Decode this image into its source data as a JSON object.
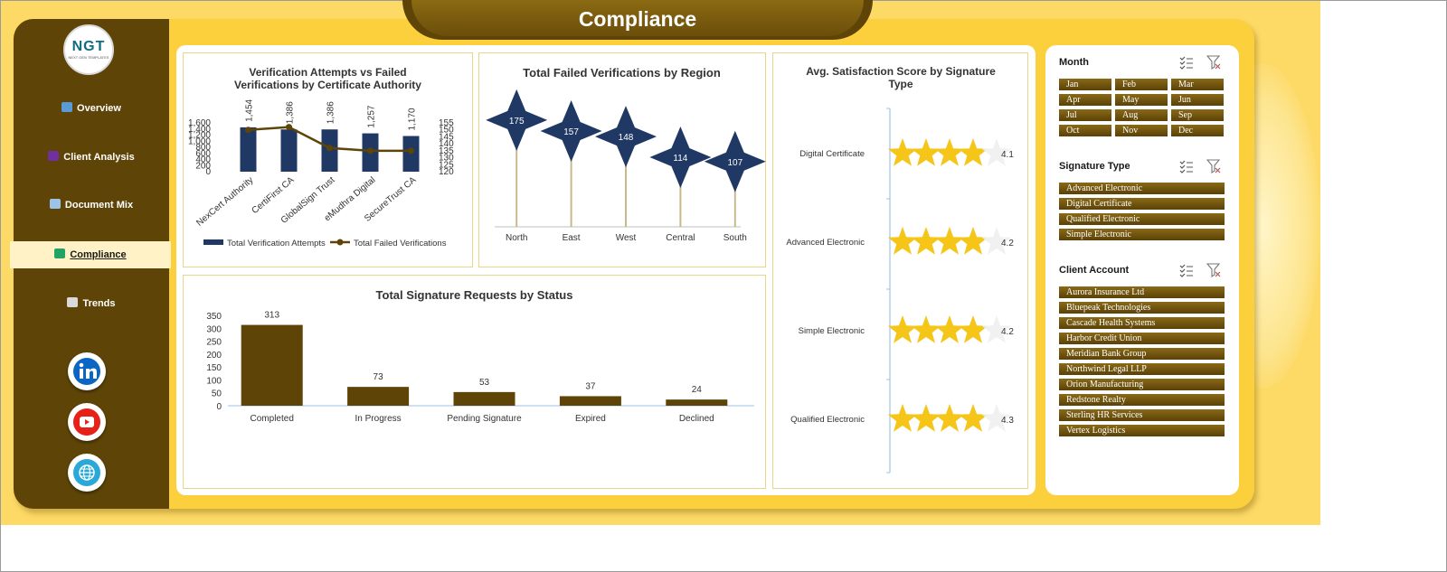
{
  "title": "Compliance",
  "logo": {
    "text": "NGT",
    "subtext": "NEXT GEN TEMPLATES"
  },
  "nav": [
    {
      "label": "Overview",
      "icon": "bar-chart-icon"
    },
    {
      "label": "Client Analysis",
      "icon": "people-icon"
    },
    {
      "label": "Document Mix",
      "icon": "line-chart-icon"
    },
    {
      "label": "Compliance",
      "icon": "check-icon",
      "active": true
    },
    {
      "label": "Trends",
      "icon": "clipboard-icon"
    }
  ],
  "social": [
    "linkedin-icon",
    "youtube-icon",
    "globe-icon"
  ],
  "charts": {
    "verification": {
      "title_line1": "Verification Attempts vs Failed",
      "title_line2": "Verifications by Certificate Authority",
      "legend_attempts": "Total Verification Attempts",
      "legend_failed": "Total Failed Verifications"
    },
    "region": {
      "title": "Total Failed Verifications by Region"
    },
    "status": {
      "title": "Total Signature Requests by Status"
    },
    "satisfaction": {
      "title_line1": "Avg. Satisfaction Score by Signature",
      "title_line2": "Type"
    }
  },
  "chart_data": [
    {
      "type": "bar",
      "title": "Verification Attempts vs Failed Verifications by Certificate Authority",
      "categories": [
        "NexCert Authority",
        "CertiFirst CA",
        "GlobalSign Trust",
        "eMudhra Digital",
        "SecureTrust CA"
      ],
      "series": [
        {
          "name": "Total Verification Attempts",
          "type": "bar",
          "values": [
            1454,
            1386,
            1386,
            1257,
            1170
          ],
          "labels": [
            "1,454",
            "1,386",
            "1,386",
            "1,257",
            "1,170"
          ]
        },
        {
          "name": "Total Failed Verifications",
          "type": "line",
          "axis": "secondary",
          "values": [
            150,
            152,
            137,
            135,
            135
          ]
        }
      ],
      "yticks": [
        "1,600",
        "1,400",
        "1,200",
        "1,000",
        "800",
        "600",
        "400",
        "200",
        "0"
      ],
      "y2ticks": [
        "155",
        "150",
        "145",
        "140",
        "135",
        "130",
        "125",
        "120"
      ],
      "ylim": [
        0,
        1600
      ],
      "y2lim": [
        120,
        155
      ],
      "legend": "bottom"
    },
    {
      "type": "bar",
      "title": "Total Failed Verifications by Region",
      "categories": [
        "North",
        "East",
        "West",
        "Central",
        "South"
      ],
      "values": [
        175,
        157,
        148,
        114,
        107
      ],
      "marker": "star"
    },
    {
      "type": "bar",
      "title": "Total Signature Requests by Status",
      "categories": [
        "Completed",
        "In Progress",
        "Pending Signature",
        "Expired",
        "Declined"
      ],
      "values": [
        313,
        73,
        53,
        37,
        24
      ],
      "yticks": [
        "350",
        "300",
        "250",
        "200",
        "150",
        "100",
        "50",
        "0"
      ],
      "ylim": [
        0,
        350
      ]
    },
    {
      "type": "bar",
      "title": "Avg. Satisfaction Score by Signature Type",
      "categories": [
        "Digital Certificate",
        "Advanced Electronic",
        "Simple Electronic",
        "Qualified Electronic"
      ],
      "values": [
        4.1,
        4.2,
        4.2,
        4.3
      ],
      "labels": [
        "4.1",
        "4.2",
        "4.2",
        "4.3"
      ],
      "max": 5,
      "marker": "star-rating"
    }
  ],
  "slicers": {
    "month": {
      "title": "Month",
      "items": [
        "Jan",
        "Feb",
        "Mar",
        "Apr",
        "May",
        "Jun",
        "Jul",
        "Aug",
        "Sep",
        "Oct",
        "Nov",
        "Dec"
      ]
    },
    "signature_type": {
      "title": "Signature Type",
      "items": [
        "Advanced Electronic",
        "Digital Certificate",
        "Qualified Electronic",
        "Simple Electronic"
      ]
    },
    "client_account": {
      "title": "Client Account",
      "items": [
        "Aurora Insurance Ltd",
        "Bluepeak Technologies",
        "Cascade Health Systems",
        "Harbor Credit Union",
        "Meridian Bank Group",
        "Northwind Legal LLP",
        "Orion Manufacturing",
        "Redstone Realty",
        "Sterling HR Services",
        "Vertex Logistics"
      ]
    }
  },
  "colors": {
    "navy": "#1f3864",
    "brown": "#5e4507",
    "gold": "#f5c518",
    "yellow": "#fccf3d"
  }
}
